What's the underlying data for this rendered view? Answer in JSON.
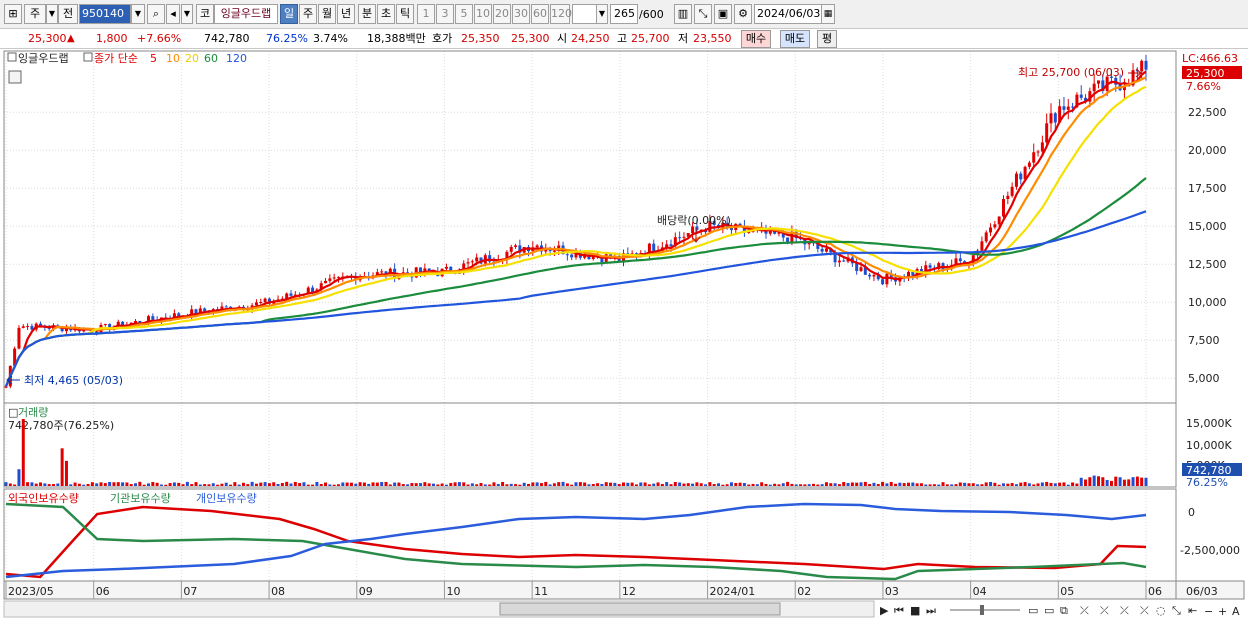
{
  "toolbar": {
    "type_code": "주",
    "market": "전",
    "stock_code": "950140",
    "market_tag": "코",
    "stock_name": "잉글우드랩",
    "periods": [
      "일",
      "주",
      "월",
      "년",
      "분",
      "초",
      "틱"
    ],
    "active_period": "일",
    "minute_options": [
      "1",
      "3",
      "5",
      "10",
      "20",
      "30",
      "60",
      "120"
    ],
    "count": "265",
    "count_max": "/600",
    "date": "2024/06/03"
  },
  "quote": {
    "price": "25,300",
    "change": "1,800",
    "change_pct": "+7.66%",
    "volume": "742,780",
    "volume_ratio": "76.25%",
    "turnover": "3.74%",
    "amount": "18,388백만",
    "ask_label": "호가",
    "ask": "25,350",
    "bid": "25,300",
    "open_label": "시",
    "open": "24,250",
    "high_label": "고",
    "high": "25,700",
    "low_label": "저",
    "low": "23,550",
    "buy_label": "매수",
    "sell_label": "매도",
    "avg_label": "평"
  },
  "chart_data": {
    "type": "candlestick",
    "title": "잉글우드랩",
    "ma_label": "종가 단순",
    "ma_periods": [
      "5",
      "10",
      "20",
      "60",
      "120"
    ],
    "ma_colors": [
      "#e00000",
      "#ff8c00",
      "#f5e000",
      "#1a8c3c",
      "#2255dd"
    ],
    "lc_label": "LC:466.63",
    "last_price": "25,300",
    "last_change_pct": "7.66%",
    "max_label": "최고 25,700 (06/03)",
    "min_label": "최저 4,465 (05/03)",
    "dividend_label": "배당락(0.00%)",
    "y_ticks": [
      "22,500",
      "20,000",
      "17,500",
      "15,000",
      "12,500",
      "10,000",
      "7,500",
      "5,000"
    ],
    "ylim": [
      3500,
      26000
    ],
    "x_labels": [
      "2023/05",
      "06",
      "07",
      "08",
      "09",
      "10",
      "11",
      "12",
      "2024/01",
      "02",
      "03",
      "04",
      "05",
      "06"
    ],
    "x_right_label": "06/03",
    "monthly_close": [
      {
        "month": "2023/05",
        "close": 8500
      },
      {
        "month": "2023/06",
        "close": 8200
      },
      {
        "month": "2023/07",
        "close": 9200
      },
      {
        "month": "2023/08",
        "close": 10000
      },
      {
        "month": "2023/09",
        "close": 11800
      },
      {
        "month": "2023/10",
        "close": 12000
      },
      {
        "month": "2023/11",
        "close": 13800
      },
      {
        "month": "2023/12",
        "close": 12800
      },
      {
        "month": "2024/01",
        "close": 15000
      },
      {
        "month": "2024/02",
        "close": 14200
      },
      {
        "month": "2024/03",
        "close": 11500
      },
      {
        "month": "2024/04",
        "close": 12800
      },
      {
        "month": "2024/05",
        "close": 22800
      },
      {
        "month": "2024/06",
        "close": 25300
      }
    ],
    "volume_panel": {
      "title": "거래량",
      "summary": "742,780주(76.25%)",
      "ticks": [
        "15,000K",
        "10,000K",
        "5,000K"
      ],
      "last_volume": "742,780",
      "last_ratio": "76.25%",
      "peak_volume_k": 16000
    },
    "holdings_panel": {
      "series": [
        {
          "name": "외국인보유수량",
          "color": "#dd0000"
        },
        {
          "name": "기관보유수량",
          "color": "#2a8a4a"
        },
        {
          "name": "개인보유수량",
          "color": "#2a5cdc"
        }
      ],
      "ticks": [
        "0",
        "-2,500,000"
      ]
    }
  },
  "bottom_controls": {
    "zoom_minus": "−",
    "zoom_plus": "+",
    "zoom_label": "A"
  }
}
